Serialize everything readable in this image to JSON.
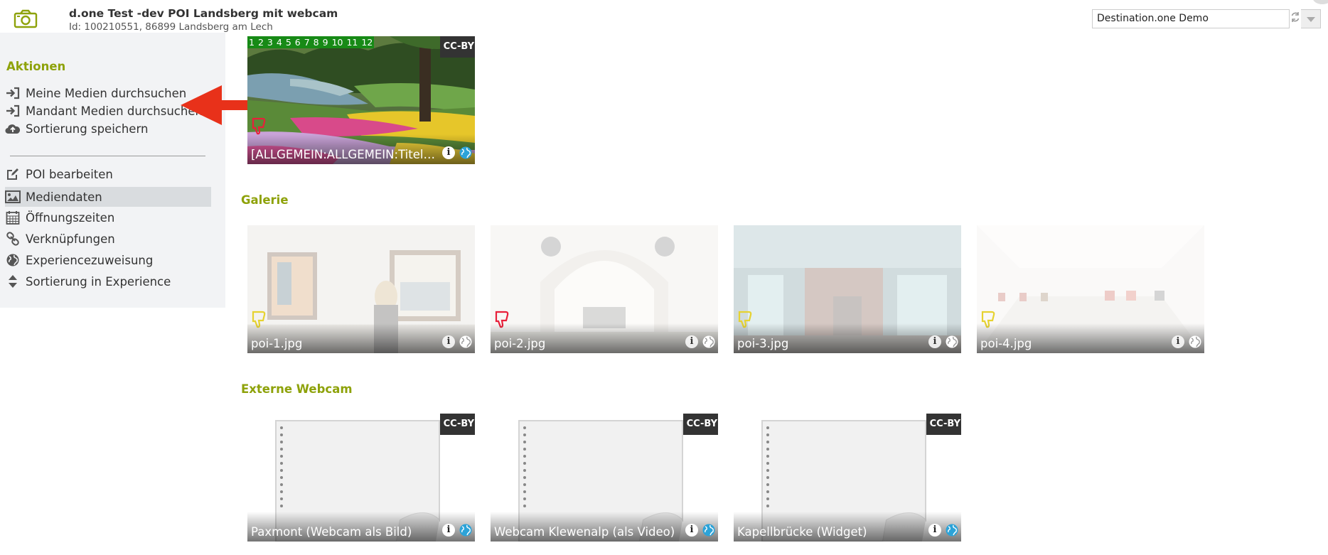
{
  "header": {
    "title": "d.one Test -dev POI Landsberg mit webcam",
    "subtitle": "Id: 100210551, 86899 Landsberg am Lech",
    "icon": "camera-icon",
    "destination_select": {
      "value": "Destination.one Demo"
    }
  },
  "sidebar": {
    "heading": "Aktionen",
    "actions": [
      {
        "label": "Meine Medien durchsuchen",
        "icon": "sign-in-icon"
      },
      {
        "label": "Mandant Medien durchsuchen",
        "icon": "sign-in-icon"
      },
      {
        "label": "Sortierung speichern",
        "icon": "cloud-upload-icon"
      }
    ],
    "nav": [
      {
        "label": "POI bearbeiten",
        "icon": "edit-icon",
        "active": false
      },
      {
        "label": "Mediendaten",
        "icon": "image-icon",
        "active": true
      },
      {
        "label": "Öffnungszeiten",
        "icon": "calendar-icon",
        "active": false
      },
      {
        "label": "Verknüpfungen",
        "icon": "link-icon",
        "active": false
      },
      {
        "label": "Experiencezuweisung",
        "icon": "globe-icon",
        "active": false
      },
      {
        "label": "Sortierung in Experience",
        "icon": "sort-icon",
        "active": false
      }
    ]
  },
  "main": {
    "featured": {
      "numbers": [
        "1",
        "2",
        "3",
        "4",
        "5",
        "6",
        "7",
        "8",
        "9",
        "10",
        "11",
        "12"
      ],
      "license": "CC-BY",
      "caption": "[ALLGEMEIN:ALLGEMEIN:Titel] Blumen"
    },
    "gallery": {
      "title": "Galerie",
      "items": [
        {
          "caption": "poi-1.jpg",
          "thumb": "yellow"
        },
        {
          "caption": "poi-2.jpg",
          "thumb": "red"
        },
        {
          "caption": "poi-3.jpg",
          "thumb": "yellow"
        },
        {
          "caption": "poi-4.jpg",
          "thumb": "yellow"
        }
      ]
    },
    "webcam": {
      "title": "Externe Webcam",
      "items": [
        {
          "caption": "Paxmont (Webcam als Bild)",
          "license": "CC-BY"
        },
        {
          "caption": "Webcam Klewenalp (als Video)",
          "license": "CC-BY"
        },
        {
          "caption": "Kapellbrücke (Widget)",
          "license": "CC-BY"
        }
      ]
    }
  },
  "colors": {
    "accent": "#8ea20a",
    "arrow": "#e8311a",
    "strip": "#178a16"
  }
}
